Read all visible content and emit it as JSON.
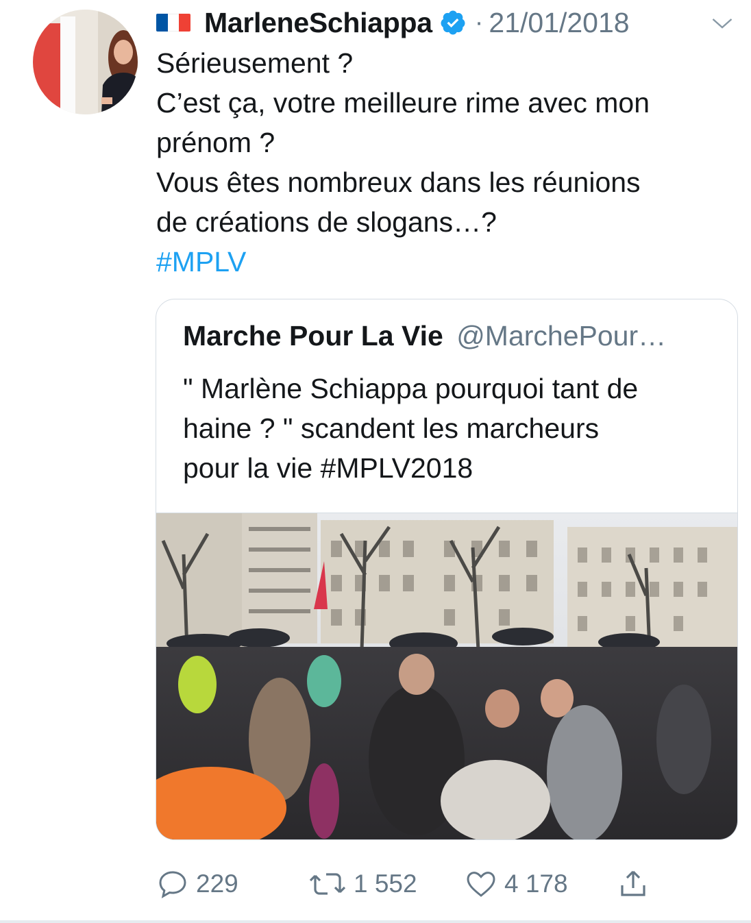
{
  "tweet": {
    "author_name": "MarleneSchiappa",
    "date": "21/01/2018",
    "separator": "·",
    "text_lines": [
      "Sérieusement ?",
      "C’est ça, votre meilleure rime avec mon",
      "prénom ?",
      "Vous êtes nombreux dans les réunions",
      "de créations de slogans…?"
    ],
    "hashtag": "#MPLV"
  },
  "quoted": {
    "name": "Marche Pour La Vie",
    "handle": "@MarchePour…",
    "text_lines": [
      "\" Marlène Schiappa pourquoi tant de",
      "haine ? \" scandent les marcheurs",
      "pour la vie #MPLV2018"
    ]
  },
  "actions": {
    "replies": "229",
    "retweets": "1 552",
    "likes": "4 178"
  },
  "colors": {
    "link": "#1da1f2",
    "secondary": "#657786",
    "flag_blue": "#0055a4",
    "flag_white": "#ffffff",
    "flag_red": "#ef4135"
  }
}
